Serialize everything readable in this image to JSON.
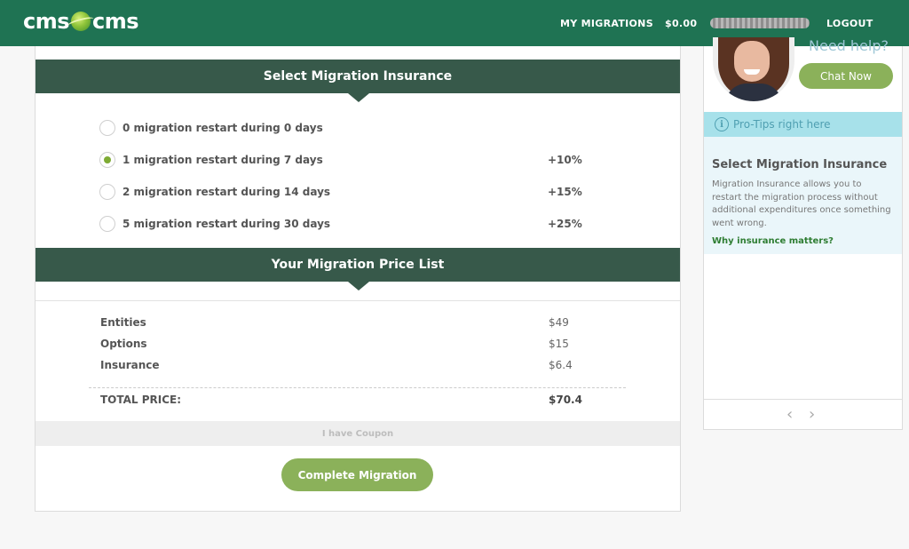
{
  "header": {
    "logo_left": "cms",
    "logo_right": "cms",
    "nav": {
      "my_migrations": "MY MIGRATIONS",
      "balance": "$0.00",
      "logout": "LOGOUT"
    }
  },
  "insurance": {
    "title": "Select Migration Insurance",
    "options": [
      {
        "label": "0 migration restart during 0 days",
        "pct": "",
        "checked": false
      },
      {
        "label": "1 migration restart during 7 days",
        "pct": "+10%",
        "checked": true
      },
      {
        "label": "2 migration restart during 14 days",
        "pct": "+15%",
        "checked": false
      },
      {
        "label": "5 migration restart during 30 days",
        "pct": "+25%",
        "checked": false
      }
    ]
  },
  "price_list": {
    "title": "Your Migration Price List",
    "items": [
      {
        "label": "Entities",
        "amount": "$49"
      },
      {
        "label": "Options",
        "amount": "$15"
      },
      {
        "label": "Insurance",
        "amount": "$6.4"
      }
    ],
    "total_label": "TOTAL PRICE:",
    "total_amount": "$70.4",
    "coupon_label": "I have Coupon",
    "complete_label": "Complete Migration"
  },
  "sidebar": {
    "need_help": "Need help?",
    "chat_label": "Chat Now",
    "protips_label": "Pro-Tips right here",
    "tip_title": "Select Migration Insurance",
    "tip_text": "Migration Insurance allows you to restart the migration process without additional expenditures once something went wrong.",
    "tip_link": "Why insurance matters?",
    "prev_arrow": "‹",
    "next_arrow": "›"
  },
  "colors": {
    "header_bg": "#1f7353",
    "section_head_bg": "#37594a",
    "accent_green": "#8bb15a",
    "protips_bg": "#a7e1ea"
  }
}
